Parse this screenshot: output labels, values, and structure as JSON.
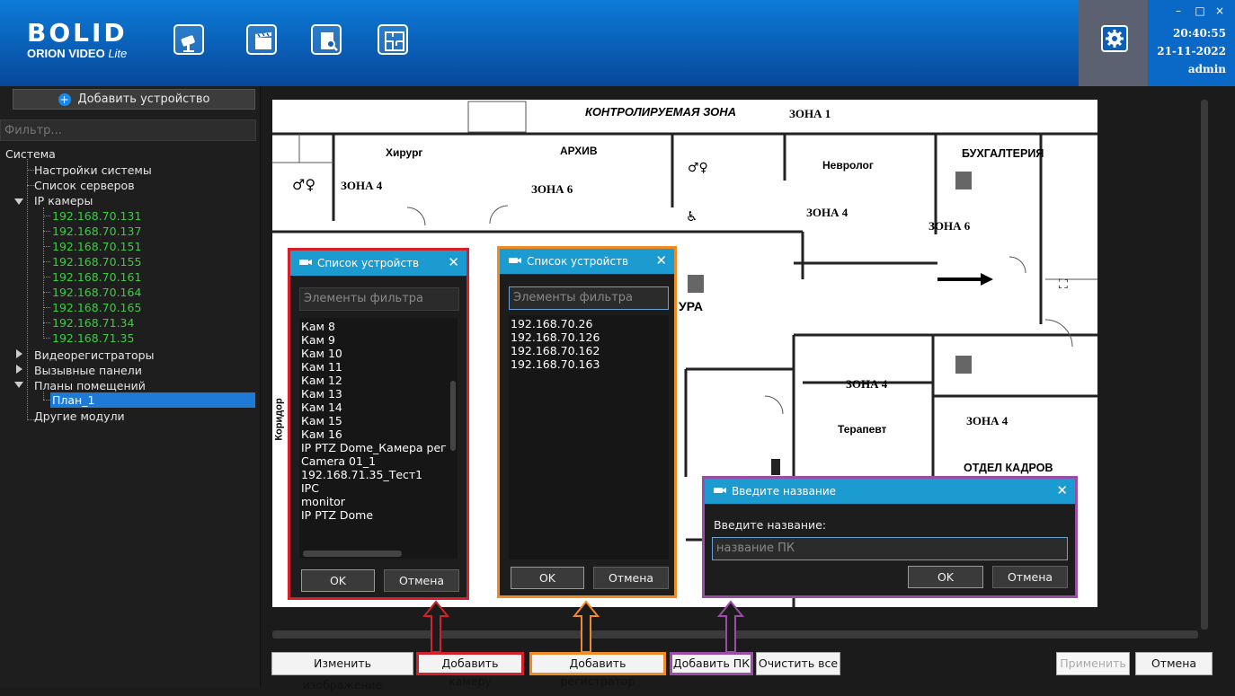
{
  "header": {
    "logo_text": "BOLID",
    "logo_product": "ORION VIDEO",
    "logo_edition": "Lite",
    "toolbar_icons": [
      "camera-icon",
      "video-clapper-icon",
      "document-search-icon",
      "floor-plan-icon"
    ],
    "settings_icon": "gear-icon",
    "time": "20:40:55",
    "date": "21-11-2022",
    "user": "admin",
    "window_controls": [
      "–",
      "□",
      "×"
    ]
  },
  "sidebar": {
    "add_device_label": "Добавить устройство",
    "filter_placeholder": "Фильтр...",
    "tree": {
      "root": "Система",
      "system_settings": "Настройки системы",
      "server_list": "Список серверов",
      "ip_cameras": "IP камеры",
      "ip_list": [
        "192.168.70.131",
        "192.168.70.137",
        "192.168.70.151",
        "192.168.70.155",
        "192.168.70.161",
        "192.168.70.164",
        "192.168.70.165",
        "192.168.71.34",
        "192.168.71.35"
      ],
      "recorders": "Видеорегистраторы",
      "call_panels": "Вызывные панели",
      "room_plans": "Планы помещений",
      "plan_1": "План_1",
      "other_modules": "Другие модули"
    }
  },
  "plan": {
    "labels": {
      "controlled_zone": "КОНТРОЛИРУЕМАЯ ЗОНА",
      "zone1": "ЗОНА 1",
      "surgeon": "Хирург",
      "archive": "АРХИВ",
      "neurologist": "Невролог",
      "accounting": "БУХГАЛТЕРИЯ",
      "zone4_a": "ЗОНА 4",
      "zone6_a": "ЗОНА 6",
      "zone4_b": "ЗОНА 4",
      "zone6_b": "ЗОНА 6",
      "ura": "УРА",
      "zone4_c": "ЗОНА 4",
      "zone4_d": "ЗОНА 4",
      "therapist": "Терапевт",
      "hr": "ОТДЕЛ КАДРОВ",
      "corridor": "Коридор"
    }
  },
  "dialog_cameras": {
    "title": "Список устройств",
    "filter_placeholder": "Элементы фильтра",
    "items": [
      "Кам 8",
      "Кам 9",
      "Кам 10",
      "Кам 11",
      "Кам 12",
      "Кам 13",
      "Кам 14",
      "Кам 15",
      "Кам 16",
      "IP PTZ Dome_Камера рег",
      "Camera 01_1",
      "192.168.71.35_Тест1",
      "IPC",
      "monitor",
      "IP PTZ Dome"
    ],
    "ok": "OK",
    "cancel": "Отмена"
  },
  "dialog_recorders": {
    "title": "Список устройств",
    "filter_placeholder": "Элементы фильтра",
    "items": [
      "192.168.70.26",
      "192.168.70.126",
      "192.168.70.162",
      "192.168.70.163"
    ],
    "ok": "OK",
    "cancel": "Отмена"
  },
  "dialog_name": {
    "title": "Введите название",
    "prompt": "Введите название:",
    "placeholder": "название ПК",
    "ok": "OK",
    "cancel": "Отмена"
  },
  "bottom_bar": {
    "change_image": "Изменить изображение",
    "add_camera": "Добавить камеру",
    "add_recorder": "Добавить регистратор",
    "add_pc": "Добавить ПК",
    "clear_all": "Очистить все",
    "apply": "Применить",
    "cancel": "Отмена"
  },
  "colors": {
    "header_blue": "#0a5fb6",
    "dialog_title": "#1c9bd1",
    "ip_green": "#34d13c",
    "selection": "#1f7ad6",
    "highlight_red": "#d4202a",
    "highlight_orange": "#f08a24",
    "highlight_purple": "#9b4ca6"
  }
}
